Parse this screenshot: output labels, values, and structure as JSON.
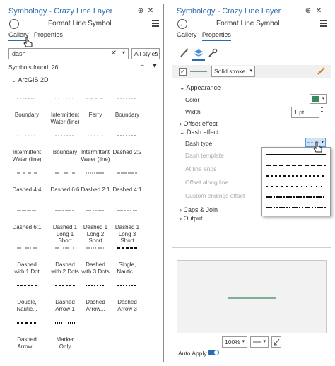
{
  "left": {
    "title": "Symbology - Crazy Line Layer",
    "subtitle": "Format Line Symbol",
    "tabs": [
      "Gallery",
      "Properties"
    ],
    "search_value": "dash",
    "style_filter": "All styles",
    "found": "Symbols found: 26",
    "group": "ArcGIS 2D",
    "symbols": [
      [
        "Boundary"
      ],
      [
        "Intermittent",
        "Water (line)"
      ],
      [
        "Ferry"
      ],
      [
        "Boundary"
      ],
      [
        "Intermittent",
        "Water (line)"
      ],
      [
        "Boundary"
      ],
      [
        "Intermittent",
        "Water (line)"
      ],
      [
        "Dashed 2:2"
      ],
      [
        "Dashed 4:4"
      ],
      [
        "Dashed 6:6"
      ],
      [
        "Dashed 2:1"
      ],
      [
        "Dashed 4:1"
      ],
      [
        "Dashed 6:1"
      ],
      [
        "Dashed 1",
        "Long 1",
        "Short"
      ],
      [
        "Dashed 1",
        "Long 2",
        "Short"
      ],
      [
        "Dashed 1",
        "Long 3",
        "Short"
      ],
      [
        "Dashed",
        "with 1 Dot"
      ],
      [
        "Dashed",
        "with 2 Dots"
      ],
      [
        "Dashed",
        "with 3 Dots"
      ],
      [
        "Single,",
        "Nautic..."
      ],
      [
        "Double,",
        "Nautic..."
      ],
      [
        "Dashed",
        "Arrow 1"
      ],
      [
        "Dashed",
        "Arrow..."
      ],
      [
        "Dashed",
        "Arrow 3"
      ],
      [
        "Dashed",
        "Arrow..."
      ],
      [
        "Marker",
        "Only"
      ]
    ]
  },
  "right": {
    "title": "Symbology - Crazy Line Layer",
    "subtitle": "Format Line Symbol",
    "tabs": [
      "Gallery",
      "Properties"
    ],
    "layer_type": "Solid stroke",
    "appearance": "Appearance",
    "color_label": "Color",
    "color_value": "#3a8a5c",
    "width_label": "Width",
    "width_value": "1 pt",
    "offset_effect": "Offset effect",
    "dash_effect": "Dash effect",
    "dash_type": "Dash type",
    "dash_template": "Dash template",
    "at_line_ends": "At line ends",
    "offset_along_line": "Offset along line",
    "custom_endings_offset": "Custom endings offset",
    "caps_join": "Caps & Join",
    "output": "Output",
    "zoom": "100%",
    "auto_apply": "Auto Apply"
  }
}
